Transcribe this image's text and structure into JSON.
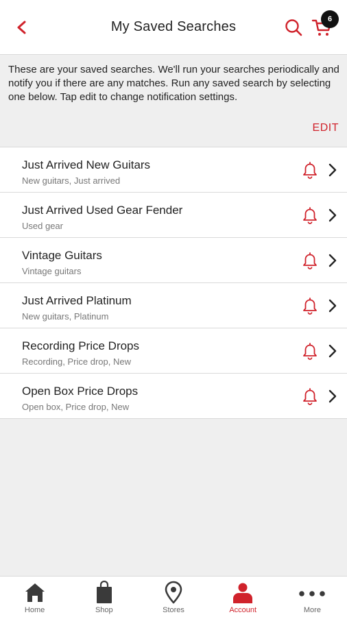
{
  "header": {
    "title": "My Saved Searches",
    "cart_count": "6"
  },
  "intro": {
    "text": "These are your saved searches. We'll run your searches periodically and notify you if there are any matches. Run any saved search by selecting one below. Tap edit to change notification settings.",
    "edit_label": "EDIT"
  },
  "searches": [
    {
      "title": "Just Arrived New Guitars",
      "subtitle": "New guitars, Just arrived"
    },
    {
      "title": "Just Arrived Used Gear Fender",
      "subtitle": "Used gear"
    },
    {
      "title": "Vintage Guitars",
      "subtitle": "Vintage guitars"
    },
    {
      "title": "Just Arrived Platinum",
      "subtitle": "New guitars, Platinum"
    },
    {
      "title": "Recording Price Drops",
      "subtitle": "Recording, Price drop, New"
    },
    {
      "title": "Open Box Price Drops",
      "subtitle": "Open box, Price drop, New"
    }
  ],
  "tabbar": {
    "items": [
      {
        "label": "Home",
        "icon": "home-icon"
      },
      {
        "label": "Shop",
        "icon": "shopping-bag-icon"
      },
      {
        "label": "Stores",
        "icon": "location-pin-icon"
      },
      {
        "label": "Account",
        "icon": "person-icon"
      },
      {
        "label": "More",
        "icon": "more-dots-icon"
      }
    ],
    "active_index": 3
  },
  "colors": {
    "accent": "#d0222b",
    "background": "#efefef",
    "surface": "#ffffff"
  }
}
